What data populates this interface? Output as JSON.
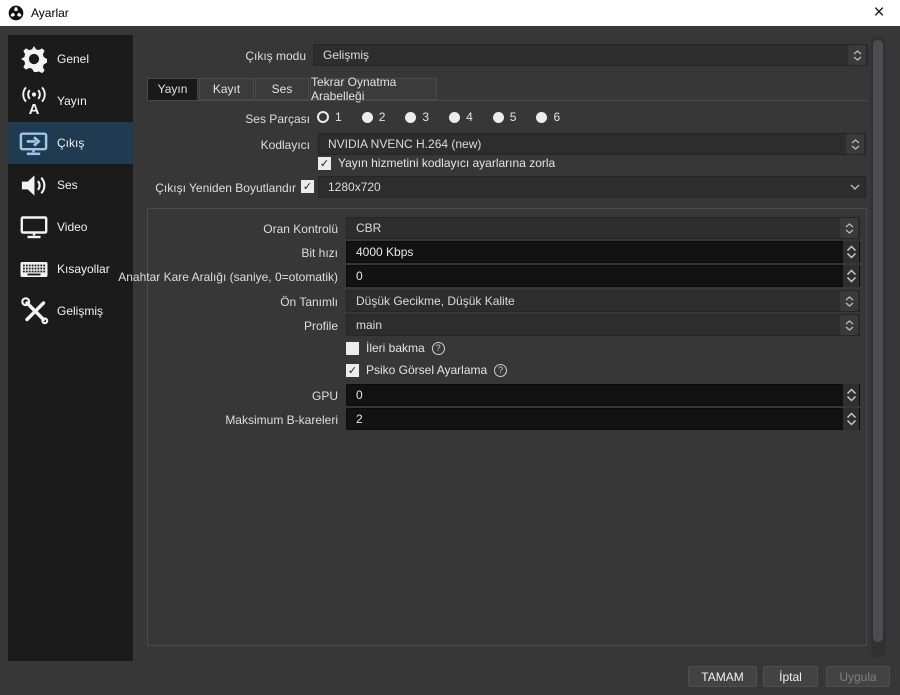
{
  "colors": {
    "titlebar_bg": "#ffffff",
    "dialog_bg": "#373737",
    "sidebar_bg": "#1b1b1c",
    "selected_item_bg": "#1f3a51",
    "selected_icon_blue": "#9ec5e5",
    "field_dark_bg": "#121213",
    "combo_bg": "#2d2d2d"
  },
  "titlebar": {
    "title": "Ayarlar",
    "close": "×"
  },
  "sidebar": {
    "selected": "Çıkış",
    "items": [
      {
        "label": "Genel"
      },
      {
        "label": "Yayın"
      },
      {
        "label": "Çıkış"
      },
      {
        "label": "Ses"
      },
      {
        "label": "Video"
      },
      {
        "label": "Kısayollar"
      },
      {
        "label": "Gelişmiş"
      }
    ]
  },
  "output_mode": {
    "label": "Çıkış modu",
    "value": "Gelişmiş"
  },
  "tabs": {
    "items": [
      {
        "label": "Yayın",
        "active": true
      },
      {
        "label": "Kayıt",
        "active": false
      },
      {
        "label": "Ses",
        "active": false
      },
      {
        "label": "Tekrar Oynatma Arabelleği",
        "active": false
      }
    ]
  },
  "stream": {
    "audio_track": {
      "label": "Ses Parçası",
      "selected": "1",
      "options": [
        "1",
        "2",
        "3",
        "4",
        "5",
        "6"
      ]
    },
    "encoder": {
      "label": "Kodlayıcı",
      "value": "NVIDIA NVENC H.264 (new)"
    },
    "enforce_service": {
      "label": "Yayın hizmetini kodlayıcı ayarlarına zorla",
      "checked": true
    },
    "rescale": {
      "label": "Çıkışı Yeniden Boyutlandır",
      "checked": true,
      "value": "1280x720"
    },
    "encoder_settings": {
      "rate_control": {
        "label": "Oran Kontrolü",
        "value": "CBR"
      },
      "bitrate": {
        "label": "Bit hızı",
        "value": "4000 Kbps"
      },
      "keyframe_interval": {
        "label": "Anahtar Kare Aralığı (saniye, 0=otomatik)",
        "value": "0"
      },
      "preset": {
        "label": "Ön Tanımlı",
        "value": "Düşük Gecikme, Düşük Kalite"
      },
      "profile": {
        "label": "Profile",
        "value": "main"
      },
      "look_ahead": {
        "label": "İleri bakma",
        "checked": false
      },
      "psycho_visual": {
        "label": "Psiko Görsel Ayarlama",
        "checked": true
      },
      "gpu": {
        "label": "GPU",
        "value": "0"
      },
      "max_b_frames": {
        "label": "Maksimum B-kareleri",
        "value": "2"
      }
    }
  },
  "footer": {
    "ok": "TAMAM",
    "cancel": "İptal",
    "apply": "Uygula",
    "apply_disabled": true
  },
  "checkmark": "✓"
}
